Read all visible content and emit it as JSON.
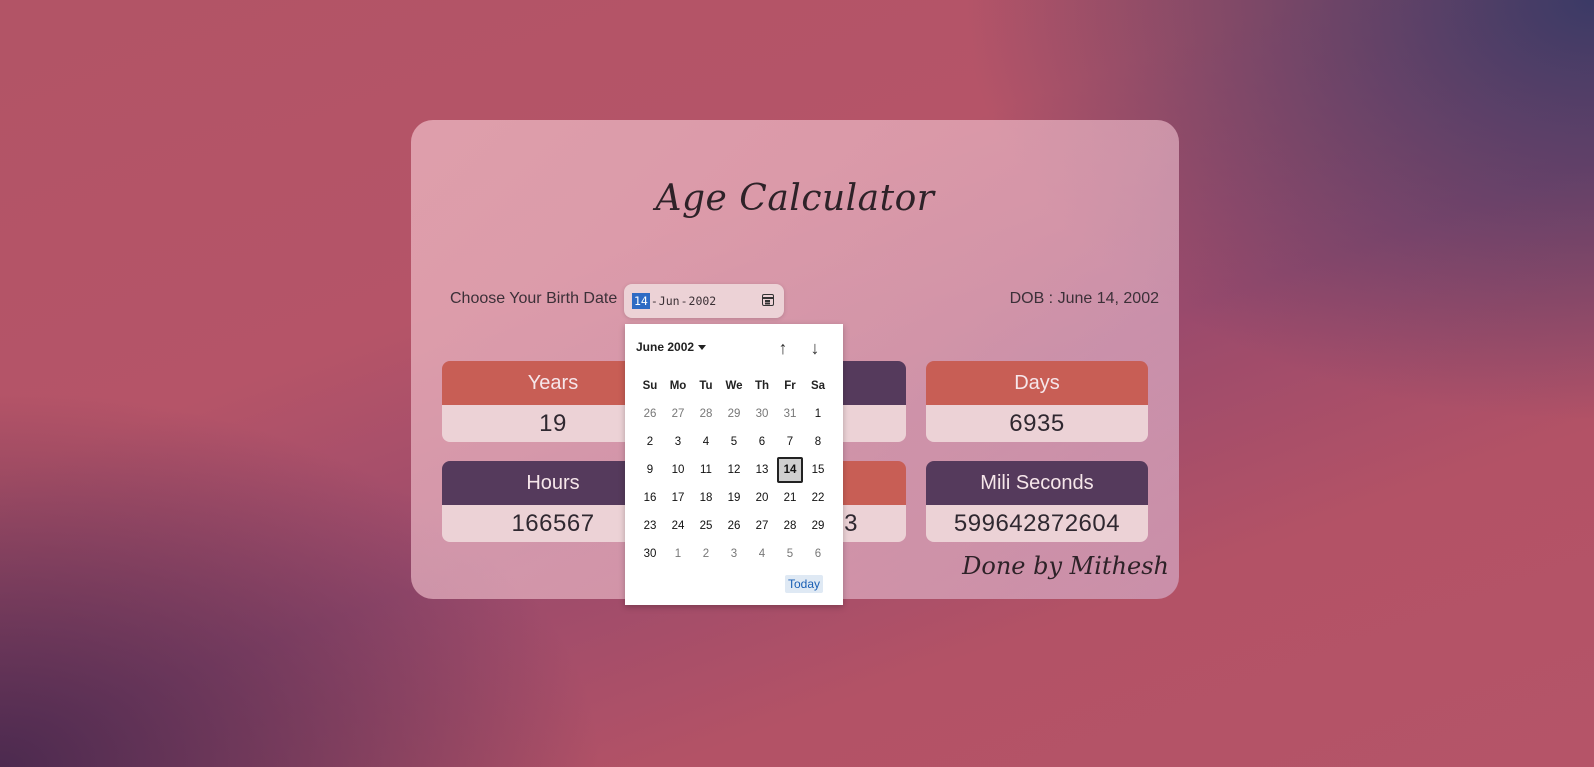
{
  "app": {
    "title": "Age Calculator",
    "credit": "Done by Mithesh"
  },
  "form": {
    "label": "Choose Your Birth Date",
    "date": {
      "day": "14",
      "month": "Jun",
      "year": "2002",
      "separator": "-"
    },
    "dob_text": "DOB : June 14, 2002"
  },
  "stats": [
    {
      "label": "Years",
      "value": "19",
      "color": "#c85e55"
    },
    {
      "label": "Days",
      "value": "6935",
      "color": "#c85e55"
    },
    {
      "label": "Hours",
      "value": "166567",
      "color": "#553a5c"
    },
    {
      "label": "Mili Seconds",
      "value": "599642872604",
      "color": "#553a5c"
    },
    {
      "label": "",
      "value": "3",
      "color": "#c85e55"
    }
  ],
  "picker": {
    "month_label": "June 2002",
    "up_arrow": "↑",
    "down_arrow": "↓",
    "weekdays": [
      "Su",
      "Mo",
      "Tu",
      "We",
      "Th",
      "Fr",
      "Sa"
    ],
    "weeks": [
      [
        "26",
        "27",
        "28",
        "29",
        "30",
        "31",
        "1"
      ],
      [
        "2",
        "3",
        "4",
        "5",
        "6",
        "7",
        "8"
      ],
      [
        "9",
        "10",
        "11",
        "12",
        "13",
        "14",
        "15"
      ],
      [
        "16",
        "17",
        "18",
        "19",
        "20",
        "21",
        "22"
      ],
      [
        "23",
        "24",
        "25",
        "26",
        "27",
        "28",
        "29"
      ],
      [
        "30",
        "1",
        "2",
        "3",
        "4",
        "5",
        "6"
      ]
    ],
    "selected_day": "14",
    "today_label": "Today"
  },
  "colors": {
    "accent_orange": "#c85e55",
    "accent_purple": "#553a5c",
    "selection_blue": "#2f6bc4"
  }
}
